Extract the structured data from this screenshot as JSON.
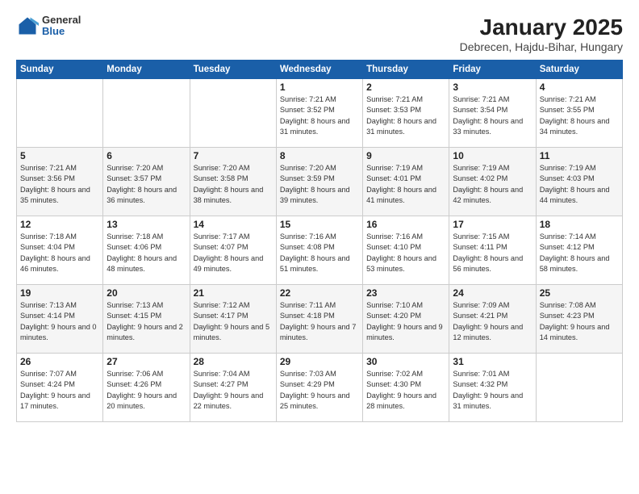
{
  "logo": {
    "general": "General",
    "blue": "Blue"
  },
  "title": "January 2025",
  "subtitle": "Debrecen, Hajdu-Bihar, Hungary",
  "weekdays": [
    "Sunday",
    "Monday",
    "Tuesday",
    "Wednesday",
    "Thursday",
    "Friday",
    "Saturday"
  ],
  "weeks": [
    [
      {
        "day": "",
        "info": ""
      },
      {
        "day": "",
        "info": ""
      },
      {
        "day": "",
        "info": ""
      },
      {
        "day": "1",
        "info": "Sunrise: 7:21 AM\nSunset: 3:52 PM\nDaylight: 8 hours and 31 minutes."
      },
      {
        "day": "2",
        "info": "Sunrise: 7:21 AM\nSunset: 3:53 PM\nDaylight: 8 hours and 31 minutes."
      },
      {
        "day": "3",
        "info": "Sunrise: 7:21 AM\nSunset: 3:54 PM\nDaylight: 8 hours and 33 minutes."
      },
      {
        "day": "4",
        "info": "Sunrise: 7:21 AM\nSunset: 3:55 PM\nDaylight: 8 hours and 34 minutes."
      }
    ],
    [
      {
        "day": "5",
        "info": "Sunrise: 7:21 AM\nSunset: 3:56 PM\nDaylight: 8 hours and 35 minutes."
      },
      {
        "day": "6",
        "info": "Sunrise: 7:20 AM\nSunset: 3:57 PM\nDaylight: 8 hours and 36 minutes."
      },
      {
        "day": "7",
        "info": "Sunrise: 7:20 AM\nSunset: 3:58 PM\nDaylight: 8 hours and 38 minutes."
      },
      {
        "day": "8",
        "info": "Sunrise: 7:20 AM\nSunset: 3:59 PM\nDaylight: 8 hours and 39 minutes."
      },
      {
        "day": "9",
        "info": "Sunrise: 7:19 AM\nSunset: 4:01 PM\nDaylight: 8 hours and 41 minutes."
      },
      {
        "day": "10",
        "info": "Sunrise: 7:19 AM\nSunset: 4:02 PM\nDaylight: 8 hours and 42 minutes."
      },
      {
        "day": "11",
        "info": "Sunrise: 7:19 AM\nSunset: 4:03 PM\nDaylight: 8 hours and 44 minutes."
      }
    ],
    [
      {
        "day": "12",
        "info": "Sunrise: 7:18 AM\nSunset: 4:04 PM\nDaylight: 8 hours and 46 minutes."
      },
      {
        "day": "13",
        "info": "Sunrise: 7:18 AM\nSunset: 4:06 PM\nDaylight: 8 hours and 48 minutes."
      },
      {
        "day": "14",
        "info": "Sunrise: 7:17 AM\nSunset: 4:07 PM\nDaylight: 8 hours and 49 minutes."
      },
      {
        "day": "15",
        "info": "Sunrise: 7:16 AM\nSunset: 4:08 PM\nDaylight: 8 hours and 51 minutes."
      },
      {
        "day": "16",
        "info": "Sunrise: 7:16 AM\nSunset: 4:10 PM\nDaylight: 8 hours and 53 minutes."
      },
      {
        "day": "17",
        "info": "Sunrise: 7:15 AM\nSunset: 4:11 PM\nDaylight: 8 hours and 56 minutes."
      },
      {
        "day": "18",
        "info": "Sunrise: 7:14 AM\nSunset: 4:12 PM\nDaylight: 8 hours and 58 minutes."
      }
    ],
    [
      {
        "day": "19",
        "info": "Sunrise: 7:13 AM\nSunset: 4:14 PM\nDaylight: 9 hours and 0 minutes."
      },
      {
        "day": "20",
        "info": "Sunrise: 7:13 AM\nSunset: 4:15 PM\nDaylight: 9 hours and 2 minutes."
      },
      {
        "day": "21",
        "info": "Sunrise: 7:12 AM\nSunset: 4:17 PM\nDaylight: 9 hours and 5 minutes."
      },
      {
        "day": "22",
        "info": "Sunrise: 7:11 AM\nSunset: 4:18 PM\nDaylight: 9 hours and 7 minutes."
      },
      {
        "day": "23",
        "info": "Sunrise: 7:10 AM\nSunset: 4:20 PM\nDaylight: 9 hours and 9 minutes."
      },
      {
        "day": "24",
        "info": "Sunrise: 7:09 AM\nSunset: 4:21 PM\nDaylight: 9 hours and 12 minutes."
      },
      {
        "day": "25",
        "info": "Sunrise: 7:08 AM\nSunset: 4:23 PM\nDaylight: 9 hours and 14 minutes."
      }
    ],
    [
      {
        "day": "26",
        "info": "Sunrise: 7:07 AM\nSunset: 4:24 PM\nDaylight: 9 hours and 17 minutes."
      },
      {
        "day": "27",
        "info": "Sunrise: 7:06 AM\nSunset: 4:26 PM\nDaylight: 9 hours and 20 minutes."
      },
      {
        "day": "28",
        "info": "Sunrise: 7:04 AM\nSunset: 4:27 PM\nDaylight: 9 hours and 22 minutes."
      },
      {
        "day": "29",
        "info": "Sunrise: 7:03 AM\nSunset: 4:29 PM\nDaylight: 9 hours and 25 minutes."
      },
      {
        "day": "30",
        "info": "Sunrise: 7:02 AM\nSunset: 4:30 PM\nDaylight: 9 hours and 28 minutes."
      },
      {
        "day": "31",
        "info": "Sunrise: 7:01 AM\nSunset: 4:32 PM\nDaylight: 9 hours and 31 minutes."
      },
      {
        "day": "",
        "info": ""
      }
    ]
  ]
}
